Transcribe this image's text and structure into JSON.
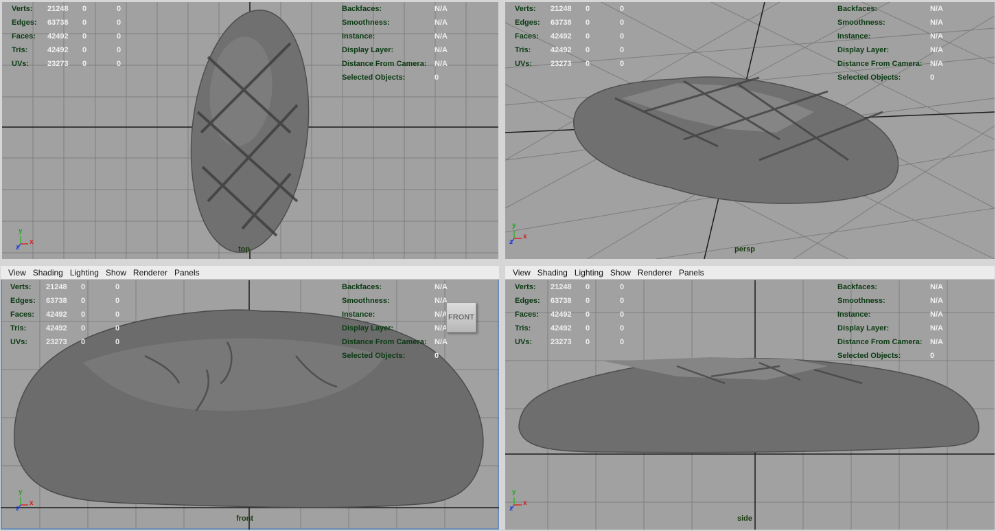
{
  "hud": {
    "stats": [
      {
        "label": "Verts:",
        "v1": "21248",
        "v2": "0",
        "v3": "0"
      },
      {
        "label": "Edges:",
        "v1": "63738",
        "v2": "0",
        "v3": "0"
      },
      {
        "label": "Faces:",
        "v1": "42492",
        "v2": "0",
        "v3": "0"
      },
      {
        "label": "Tris:",
        "v1": "42492",
        "v2": "0",
        "v3": "0"
      },
      {
        "label": "UVs:",
        "v1": "23273",
        "v2": "0",
        "v3": "0"
      }
    ],
    "props": [
      {
        "label": "Backfaces:",
        "value": "N/A"
      },
      {
        "label": "Smoothness:",
        "value": "N/A"
      },
      {
        "label": "Instance:",
        "value": "N/A"
      },
      {
        "label": "Display Layer:",
        "value": "N/A"
      },
      {
        "label": "Distance From Camera:",
        "value": "N/A"
      },
      {
        "label": "Selected Objects:",
        "value": "0"
      }
    ]
  },
  "menu": [
    "View",
    "Shading",
    "Lighting",
    "Show",
    "Renderer",
    "Panels"
  ],
  "viewports": {
    "top": {
      "camera": "top"
    },
    "persp": {
      "camera": "persp"
    },
    "front": {
      "camera": "front",
      "viewcube": "FRONT"
    },
    "side": {
      "camera": "side"
    }
  },
  "axes": {
    "x": "x",
    "y": "y",
    "z": "z"
  },
  "colors": {
    "viewport_bg": "#a1a1a1",
    "grid": "#7a7a7a",
    "axis_line": "#1a1a1a",
    "hud_label": "#0a3a12",
    "hud_value": "#f0f0f0",
    "mesh": "#6e6e6e"
  }
}
